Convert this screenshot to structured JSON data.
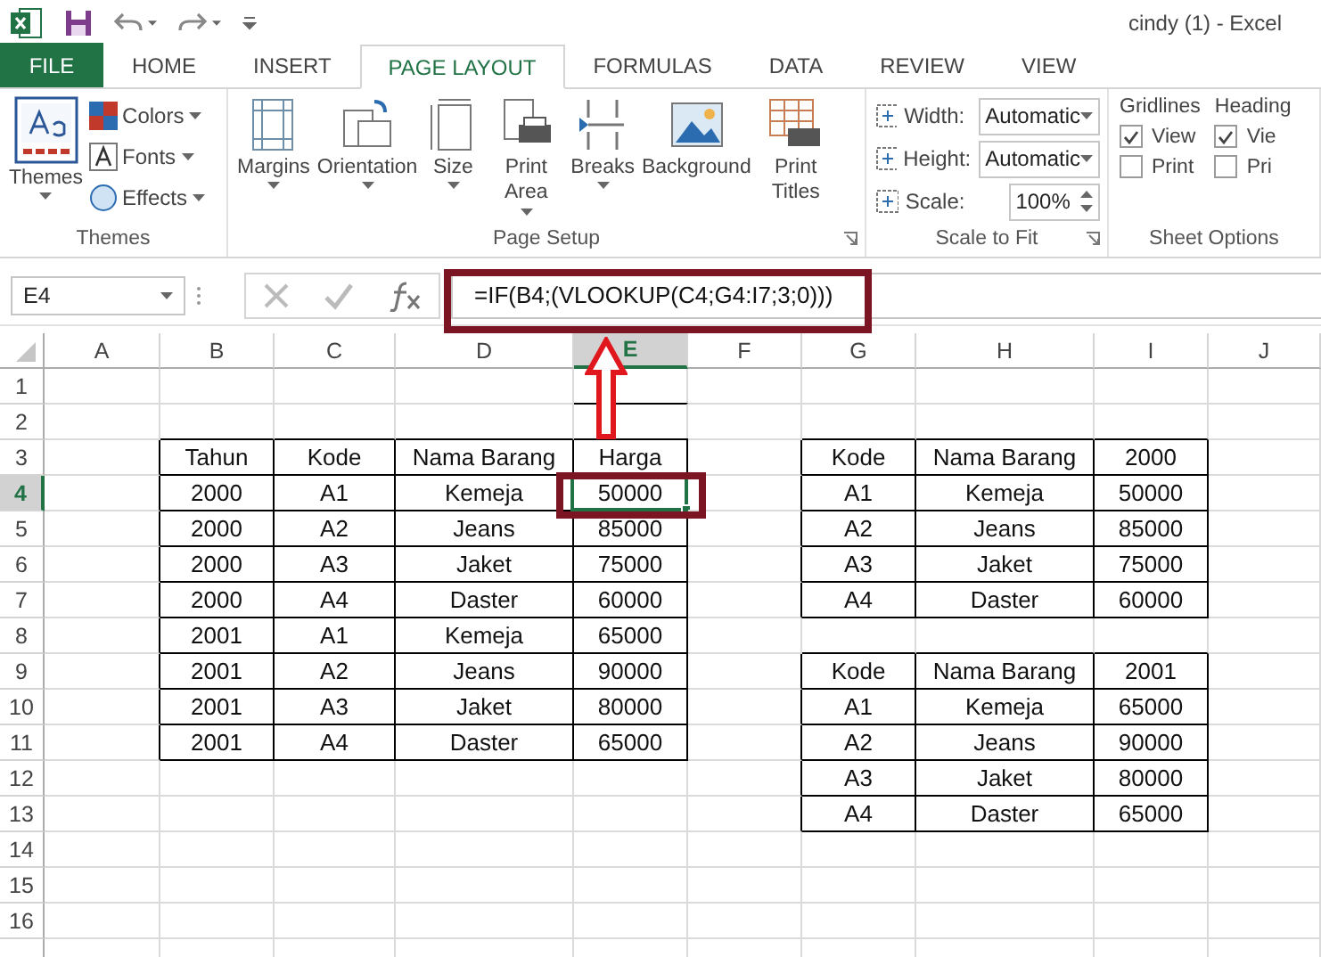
{
  "title_bar": {
    "title": "cindy (1) - Excel"
  },
  "tabs": [
    {
      "label": "FILE",
      "kind": "file",
      "selected": false
    },
    {
      "label": "HOME",
      "kind": "tab",
      "selected": false
    },
    {
      "label": "INSERT",
      "kind": "tab",
      "selected": false
    },
    {
      "label": "PAGE LAYOUT",
      "kind": "tab",
      "selected": true
    },
    {
      "label": "FORMULAS",
      "kind": "tab",
      "selected": false
    },
    {
      "label": "DATA",
      "kind": "tab",
      "selected": false
    },
    {
      "label": "REVIEW",
      "kind": "tab",
      "selected": false
    },
    {
      "label": "VIEW",
      "kind": "tab",
      "selected": false
    }
  ],
  "ribbon": {
    "groups": [
      {
        "label": "Themes",
        "kind": "themes",
        "large": [
          {
            "label": "Themes",
            "menu": true
          }
        ],
        "small": [
          {
            "label": "Colors",
            "menu": true
          },
          {
            "label": "Fonts",
            "menu": true
          },
          {
            "label": "Effects",
            "menu": true
          }
        ]
      },
      {
        "label": "Page Setup",
        "kind": "page_setup",
        "launcher": true,
        "large": [
          {
            "label": "Margins",
            "menu": true
          },
          {
            "label": "Orientation",
            "menu": true
          },
          {
            "label": "Size",
            "menu": true
          },
          {
            "label": "Print Area",
            "menu": true
          },
          {
            "label": "Breaks",
            "menu": true
          },
          {
            "label": "Background",
            "menu": false
          },
          {
            "label": "Print Titles",
            "menu": false
          }
        ]
      },
      {
        "label": "Scale to Fit",
        "kind": "scale",
        "launcher": true,
        "fields": [
          {
            "label": "Width:",
            "value": "Automatic",
            "kind": "dropdown"
          },
          {
            "label": "Height:",
            "value": "Automatic",
            "kind": "dropdown"
          },
          {
            "label": "Scale:",
            "value": "100%",
            "kind": "spinner"
          }
        ]
      },
      {
        "label": "Sheet Options",
        "kind": "sheet_options",
        "columns": [
          {
            "label": "Gridlines",
            "options": [
              {
                "label": "View",
                "checked": true
              },
              {
                "label": "Print",
                "checked": false
              }
            ]
          },
          {
            "label": "Heading",
            "options": [
              {
                "label": "Vie",
                "checked": true
              },
              {
                "label": "Pri",
                "checked": false
              }
            ]
          }
        ]
      }
    ]
  },
  "formula_bar": {
    "name_box": "E4",
    "formula": "=IF(B4;(VLOOKUP(C4;G4:I7;3;0)))"
  },
  "sheet": {
    "columns": [
      {
        "label": "A",
        "selected": false
      },
      {
        "label": "B",
        "selected": false
      },
      {
        "label": "C",
        "selected": false
      },
      {
        "label": "D",
        "selected": false
      },
      {
        "label": "E",
        "selected": true
      },
      {
        "label": "F",
        "selected": false
      },
      {
        "label": "G",
        "selected": false
      },
      {
        "label": "H",
        "selected": false
      },
      {
        "label": "I",
        "selected": false
      },
      {
        "label": "J",
        "selected": false
      }
    ],
    "rows": [
      {
        "label": "1",
        "selected": false
      },
      {
        "label": "2",
        "selected": false
      },
      {
        "label": "3",
        "selected": false
      },
      {
        "label": "4",
        "selected": true
      },
      {
        "label": "5",
        "selected": false
      },
      {
        "label": "6",
        "selected": false
      },
      {
        "label": "7",
        "selected": false
      },
      {
        "label": "8",
        "selected": false
      },
      {
        "label": "9",
        "selected": false
      },
      {
        "label": "10",
        "selected": false
      },
      {
        "label": "11",
        "selected": false
      },
      {
        "label": "12",
        "selected": false
      },
      {
        "label": "13",
        "selected": false
      },
      {
        "label": "14",
        "selected": false
      },
      {
        "label": "15",
        "selected": false
      },
      {
        "label": "16",
        "selected": false
      }
    ],
    "tables": [
      {
        "header": [
          "Tahun",
          "Kode",
          "Nama Barang",
          "Harga"
        ],
        "rows": [
          [
            "2000",
            "A1",
            "Kemeja",
            "50000"
          ],
          [
            "2000",
            "A2",
            "Jeans",
            "85000"
          ],
          [
            "2000",
            "A3",
            "Jaket",
            "75000"
          ],
          [
            "2000",
            "A4",
            "Daster",
            "60000"
          ],
          [
            "2001",
            "A1",
            "Kemeja",
            "65000"
          ],
          [
            "2001",
            "A2",
            "Jeans",
            "90000"
          ],
          [
            "2001",
            "A3",
            "Jaket",
            "80000"
          ],
          [
            "2001",
            "A4",
            "Daster",
            "65000"
          ]
        ]
      },
      {
        "header": [
          "Kode",
          "Nama Barang",
          "2000"
        ],
        "rows": [
          [
            "A1",
            "Kemeja",
            "50000"
          ],
          [
            "A2",
            "Jeans",
            "85000"
          ],
          [
            "A3",
            "Jaket",
            "75000"
          ],
          [
            "A4",
            "Daster",
            "60000"
          ]
        ]
      },
      {
        "header": [
          "Kode",
          "Nama Barang",
          "2001"
        ],
        "rows": [
          [
            "A1",
            "Kemeja",
            "65000"
          ],
          [
            "A2",
            "Jeans",
            "90000"
          ],
          [
            "A3",
            "Jaket",
            "80000"
          ],
          [
            "A4",
            "Daster",
            "65000"
          ]
        ]
      }
    ]
  }
}
